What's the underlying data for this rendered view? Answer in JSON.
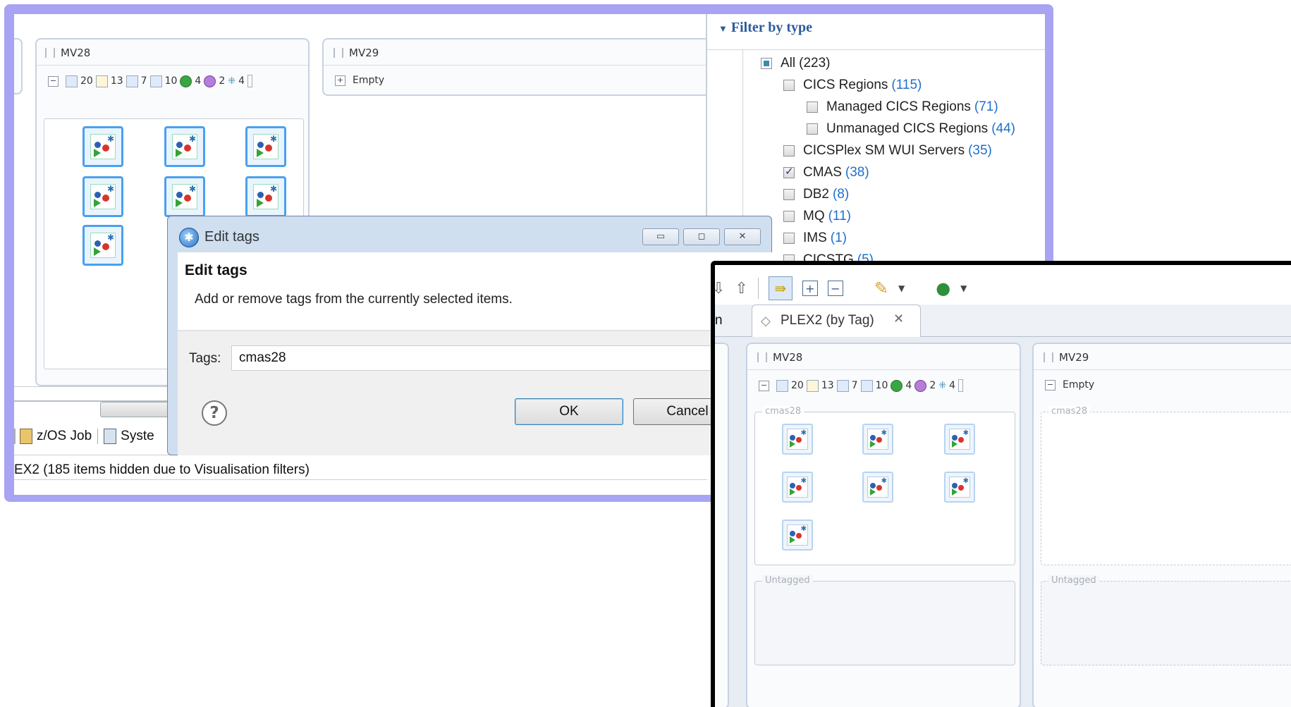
{
  "main_window": {
    "mv28": {
      "title": "MV28",
      "counts": [
        "20",
        "13",
        "7",
        "10",
        "4",
        "2",
        "4"
      ]
    },
    "mv29": {
      "title": "MV29",
      "empty_label": "Empty"
    },
    "bottom_tabs": {
      "zos_job": "z/OS Job",
      "system": "Syste"
    },
    "status_text": "EX2 (185 items hidden due to Visualisation filters)"
  },
  "filter": {
    "title": "Filter by type",
    "items": [
      {
        "label": "All",
        "count": "(223)"
      },
      {
        "label": "CICS Regions",
        "count": "(115)"
      },
      {
        "label": "Managed CICS Regions",
        "count": "(71)"
      },
      {
        "label": "Unmanaged CICS Regions",
        "count": "(44)"
      },
      {
        "label": "CICSPlex SM WUI Servers",
        "count": "(35)"
      },
      {
        "label": "CMAS",
        "count": "(38)"
      },
      {
        "label": "DB2",
        "count": "(8)"
      },
      {
        "label": "MQ",
        "count": "(11)"
      },
      {
        "label": "IMS",
        "count": "(1)"
      },
      {
        "label": "CICSTG",
        "count": "(5)"
      }
    ]
  },
  "dialog": {
    "window_title": "Edit tags",
    "heading": "Edit tags",
    "description": "Add or remove tags from the currently selected items.",
    "tags_label": "Tags:",
    "tags_value": "cmas28",
    "ok_label": "OK",
    "cancel_label": "Cancel",
    "help_glyph": "?"
  },
  "second_window": {
    "left_tab_fragment": "n",
    "tab_title": "PLEX2 (by Tag)",
    "mv28": {
      "title": "MV28",
      "counts": [
        "20",
        "13",
        "7",
        "10",
        "4",
        "2",
        "4"
      ],
      "group_label": "cmas28",
      "untagged_label": "Untagged"
    },
    "mv29": {
      "title": "MV29",
      "empty_label": "Empty",
      "group_label": "cmas28",
      "untagged_label": "Untagged"
    }
  },
  "colors": {
    "frame_accent": "#a8a3f2",
    "count_blue": "#1f6fcb",
    "icon_border_blue": "#4aa1ee"
  }
}
